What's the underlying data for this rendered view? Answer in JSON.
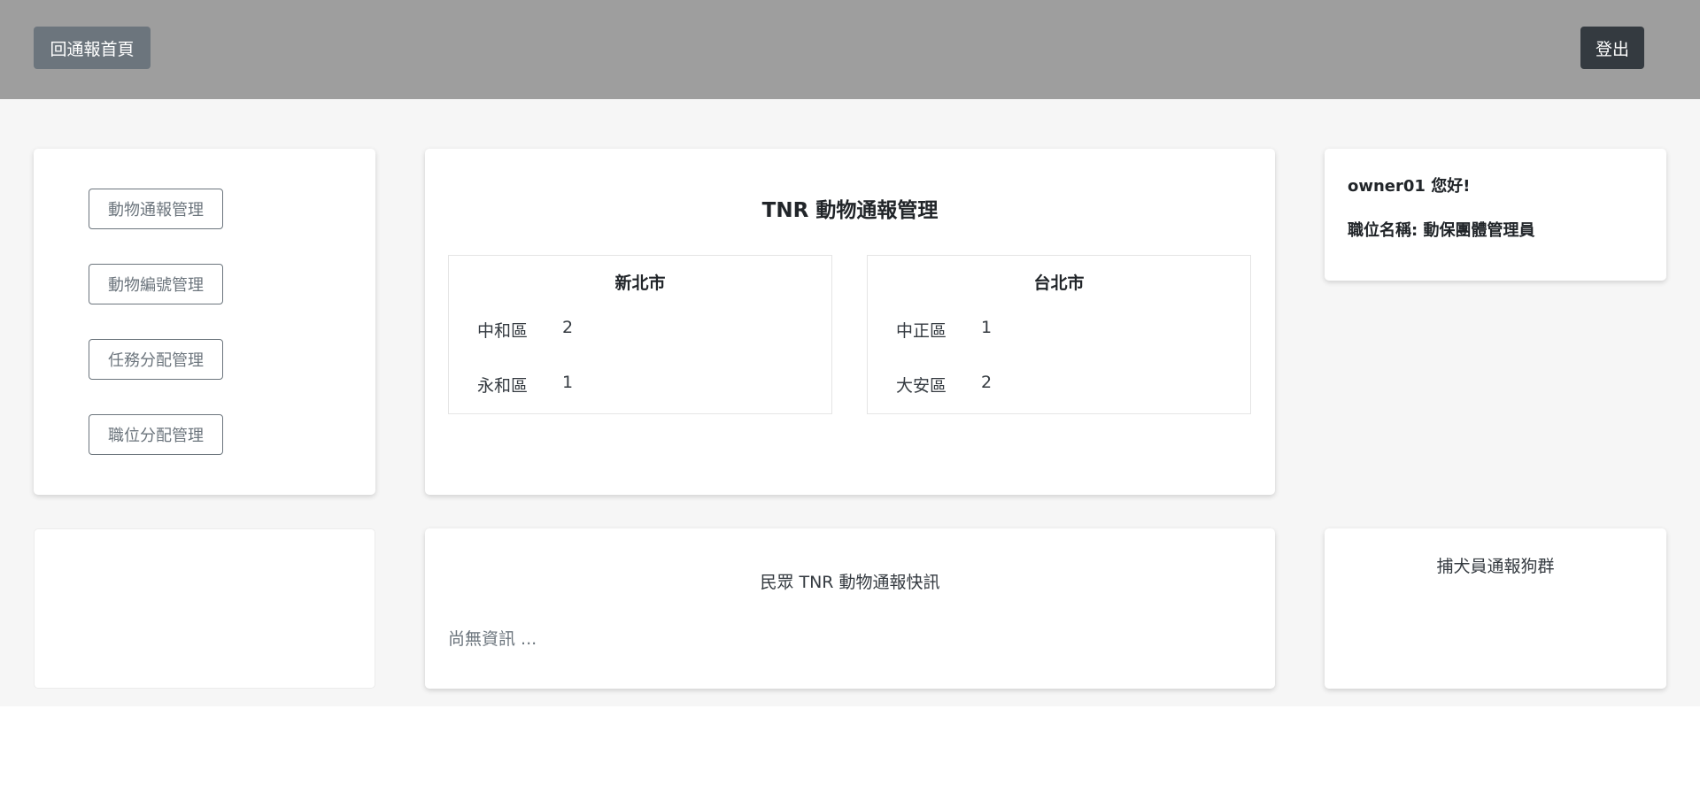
{
  "header": {
    "home_label": "回通報首頁",
    "logout_label": "登出"
  },
  "sidebar": {
    "items": [
      {
        "label": "動物通報管理"
      },
      {
        "label": "動物編號管理"
      },
      {
        "label": "任務分配管理"
      },
      {
        "label": "職位分配管理"
      }
    ]
  },
  "report_panel": {
    "title": "TNR 動物通報管理",
    "cities": [
      {
        "name": "新北市",
        "districts": [
          {
            "name": "中和區",
            "count": "2"
          },
          {
            "name": "永和區",
            "count": "1"
          }
        ]
      },
      {
        "name": "台北市",
        "districts": [
          {
            "name": "中正區",
            "count": "1"
          },
          {
            "name": "大安區",
            "count": "2"
          }
        ]
      }
    ]
  },
  "user_panel": {
    "greeting": "owner01 您好!",
    "role": "職位名稱: 動保團體管理員"
  },
  "news_panel": {
    "title": "民眾 TNR 動物通報快訊",
    "empty_text": "尚無資訊 ..."
  },
  "catcher_panel": {
    "title": "捕犬員通報狗群"
  }
}
